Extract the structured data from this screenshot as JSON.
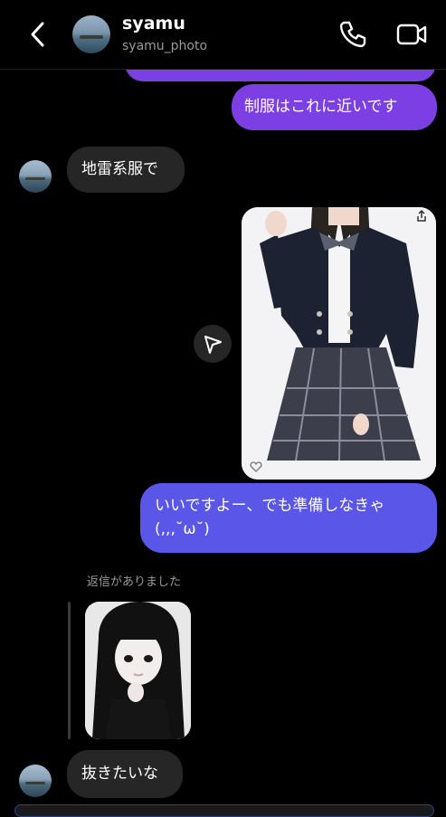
{
  "header": {
    "name": "syamu",
    "handle": "syamu_photo",
    "back_icon": "chevron-left-icon",
    "call_icon": "phone-icon",
    "video_icon": "video-camera-icon"
  },
  "messages": [
    {
      "side": "out",
      "text": "制服はこれに近いです"
    },
    {
      "side": "in",
      "text": "地雷系服で"
    },
    {
      "side": "out",
      "type": "photo",
      "content": "school uniform photo"
    },
    {
      "side": "out",
      "line1": "いいですよー、でも準備しなきゃ",
      "line2": "(,,,˘ω˘)"
    },
    {
      "side": "in",
      "type": "reply",
      "reply_label": "返信がありました"
    },
    {
      "side": "in",
      "text": "抜きたいな"
    }
  ],
  "colors": {
    "outgoing_purple": "#7b3fe4",
    "outgoing_blue": "#5a56e8",
    "incoming": "#262626",
    "background": "#000000"
  }
}
